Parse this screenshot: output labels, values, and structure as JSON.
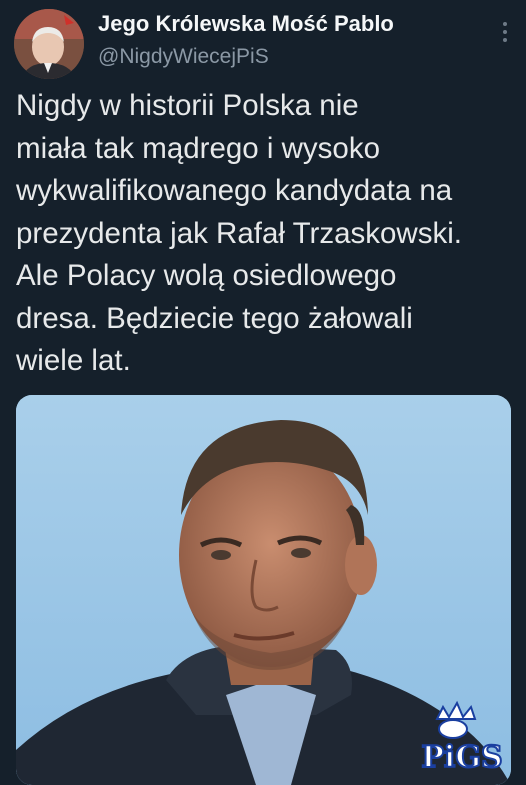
{
  "tweet": {
    "author": {
      "display_name": "Jego Królewska Mość Pablo",
      "handle": "@NigdyWiecejPiS",
      "avatar_icon": "avatar-photo"
    },
    "more_icon": "more-options-icon",
    "text": "Nigdy w historii Polska nie\nmiała tak mądrego i wysoko\nwykwalifikowanego kandydata na\nprezydenta jak Rafał Trzaskowski.\nAle Polacy wolą osiedlowego\ndresa. Będziecie tego żałowali\nwiele lat.",
    "media": {
      "type": "photo",
      "watermark": "PIGS"
    }
  },
  "colors": {
    "background": "#15202b",
    "text": "#e7e9ea",
    "secondary_text": "#8b98a5",
    "sky": "#9dc7e6"
  }
}
